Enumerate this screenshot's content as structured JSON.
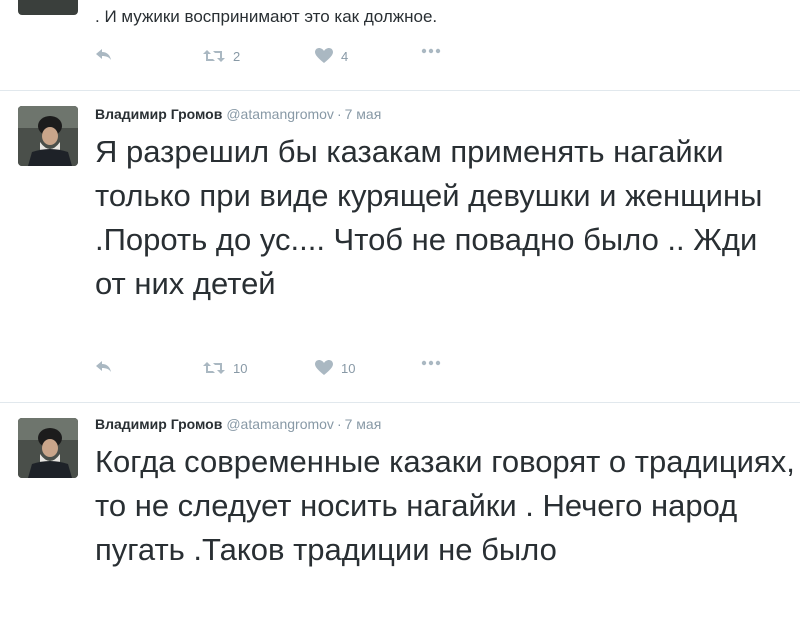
{
  "tweets": [
    {
      "text": ". И мужики  воспринимают это как должное.",
      "retweets": "2",
      "likes": "4"
    },
    {
      "name": "Владимир Громов",
      "handle": "@atamangromov",
      "sep": "·",
      "time": "7 мая",
      "text": "Я разрешил бы казакам применять нагайки только при виде курящей девушки и женщины .Пороть до ус.... Чтоб не повадно было .. Жди от них детей",
      "retweets": "10",
      "likes": "10"
    },
    {
      "name": "Владимир Громов",
      "handle": "@atamangromov",
      "sep": "·",
      "time": "7 мая",
      "text": "Когда современные казаки говорят о традициях, то не следует носить нагайки . Нечего народ пугать .Таков традиции не было"
    }
  ],
  "icons": {
    "reply": "reply-icon",
    "retweet": "retweet-icon",
    "like": "heart-icon",
    "more": "more-icon"
  },
  "colors": {
    "text": "#292f33",
    "muted": "#8899a6",
    "icon": "#aab8c2",
    "divider": "#e1e8ed"
  }
}
